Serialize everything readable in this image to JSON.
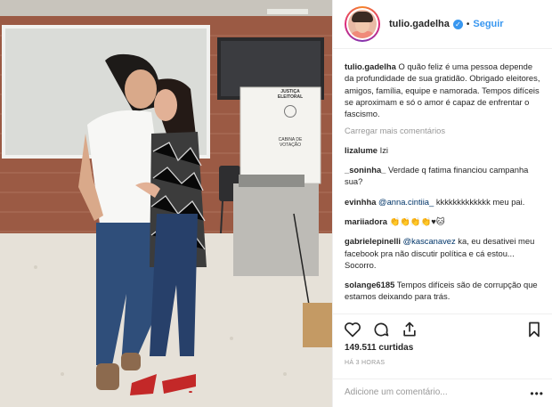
{
  "header": {
    "username": "tulio.gadelha",
    "separator": "•",
    "follow_label": "Seguir"
  },
  "photo": {
    "booth_title_line1": "JUSTIÇA",
    "booth_title_line2": "ELEITORAL",
    "booth_sub_line1": "CABINA DE",
    "booth_sub_line2": "VOTAÇÃO"
  },
  "caption": {
    "user": "tulio.gadelha",
    "text": "O quão feliz é uma pessoa depende da profundidade de sua gratidão. Obrigado eleitores, amigos, família, equipe e namorada. Tempos difíceis se aproximam e só o amor é capaz de enfrentar o fascismo."
  },
  "load_more": "Carregar mais comentários",
  "comments": [
    {
      "user": "lizalume",
      "mention": "",
      "text": "Izi"
    },
    {
      "user": "_soninha_",
      "mention": "",
      "text": "Verdade q fatima financiou campanha sua?"
    },
    {
      "user": "evinhha",
      "mention": "@anna.cintiia_",
      "text": "kkkkkkkkkkkkk meu pai."
    },
    {
      "user": "mariiadora",
      "mention": "",
      "text": "👏👏👏👏♥🐱"
    },
    {
      "user": "gabrielepinelli",
      "mention": "@kascanavez",
      "text": "ka, eu desativei meu facebook pra não discutir política e cá estou... Socorro."
    },
    {
      "user": "solange6185",
      "mention": "",
      "text": "Tempos difíceis são de corrupção que estamos deixando para trás."
    }
  ],
  "likes": {
    "count": "149.511",
    "label": "curtidas"
  },
  "timestamp": "HÁ 3 HORAS",
  "add_comment_placeholder": "Adicione um comentário...",
  "more_label": "•••"
}
